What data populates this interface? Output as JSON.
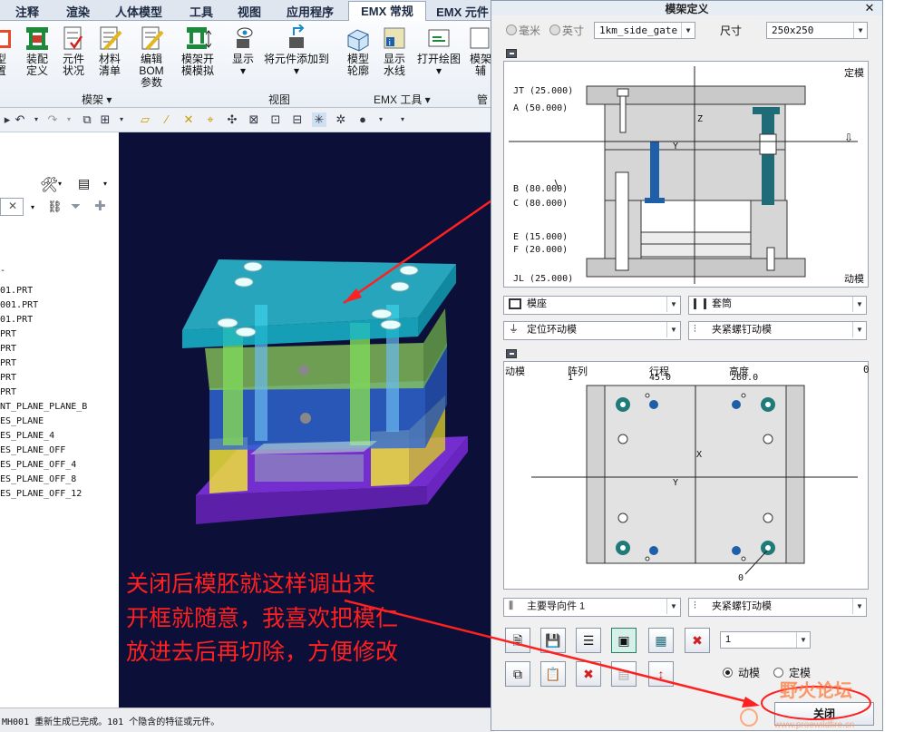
{
  "ribbon": {
    "tabs": [
      "注释",
      "渲染",
      "人体模型",
      "工具",
      "视图",
      "应用程序",
      "EMX 常规",
      "EMX 元件"
    ],
    "buttons": [
      {
        "label1": "型",
        "label2": "置"
      },
      {
        "label1": "装配",
        "label2": "定义"
      },
      {
        "label1": "元件",
        "label2": "状况"
      },
      {
        "label1": "材料",
        "label2": "清单"
      },
      {
        "label1": "编辑 BOM",
        "label2": "参数"
      },
      {
        "label1": "模架开",
        "label2": "模模拟"
      },
      {
        "label1": "显示",
        "label2": "▾"
      },
      {
        "label1": "将元件添加到",
        "label2": "▾"
      },
      {
        "label1": "模型",
        "label2": "轮廓"
      },
      {
        "label1": "显示",
        "label2": "水线"
      },
      {
        "label1": "打开绘图",
        "label2": "▾"
      },
      {
        "label1": "模架",
        "label2": "辅"
      }
    ],
    "groups": [
      "模架 ▾",
      "视图",
      "EMX 工具 ▾",
      "管"
    ]
  },
  "left_panel": {
    "tree_items": [
      "-",
      "01.PRT",
      "001.PRT",
      "01.PRT",
      "PRT",
      "PRT",
      "PRT",
      "PRT",
      "PRT",
      "NT_PLANE_PLANE_B",
      "ES_PLANE",
      "ES_PLANE_4",
      "ES_PLANE_OFF",
      "ES_PLANE_OFF_4",
      "ES_PLANE_OFF_8",
      "ES_PLANE_OFF_12"
    ]
  },
  "annotation": {
    "lines": [
      "关闭后模胚就这样调出来",
      "开框就随意，我喜欢把模仁",
      "放进去后再切除，方便修改"
    ]
  },
  "status": {
    "text": "MH001 重新生成已完成。101 个隐含的特征或元件。"
  },
  "dialog": {
    "title": "模架定义",
    "unit_mm": "毫米",
    "unit_inch": "英寸",
    "template": "1km_side_gate",
    "size_label": "尺寸",
    "size_value": "250x250",
    "top_side_label": "定模",
    "bottom_side_label": "动模",
    "plates": [
      {
        "label": "JT (25.000)"
      },
      {
        "label": "A (50.000)"
      },
      {
        "label": "B (80.000)"
      },
      {
        "label": "C (80.000)"
      },
      {
        "label": "E (15.000)"
      },
      {
        "label": "F (20.000)"
      },
      {
        "label": "JL (25.000)"
      }
    ],
    "axis_z": "Z",
    "axis_y": "Y",
    "axis_x": "X",
    "dd1": "模座",
    "dd2": "套筒",
    "dd3": "定位环动模",
    "dd4": "夹紧螺钉动模",
    "table_headers": [
      "动模",
      "阵列",
      "行程",
      "高度",
      "0"
    ],
    "table_values": [
      "1",
      "45.0",
      "260.0"
    ],
    "plan_zero": "0",
    "dd5": "主要导向件 1",
    "dd6": "夹紧螺钉动模",
    "count_value": "1",
    "radio_moving": "动模",
    "radio_fixed": "定模",
    "close_button": "关闭",
    "watermark": "野火论坛",
    "watermark_url": "www.proewildfire.cn"
  }
}
